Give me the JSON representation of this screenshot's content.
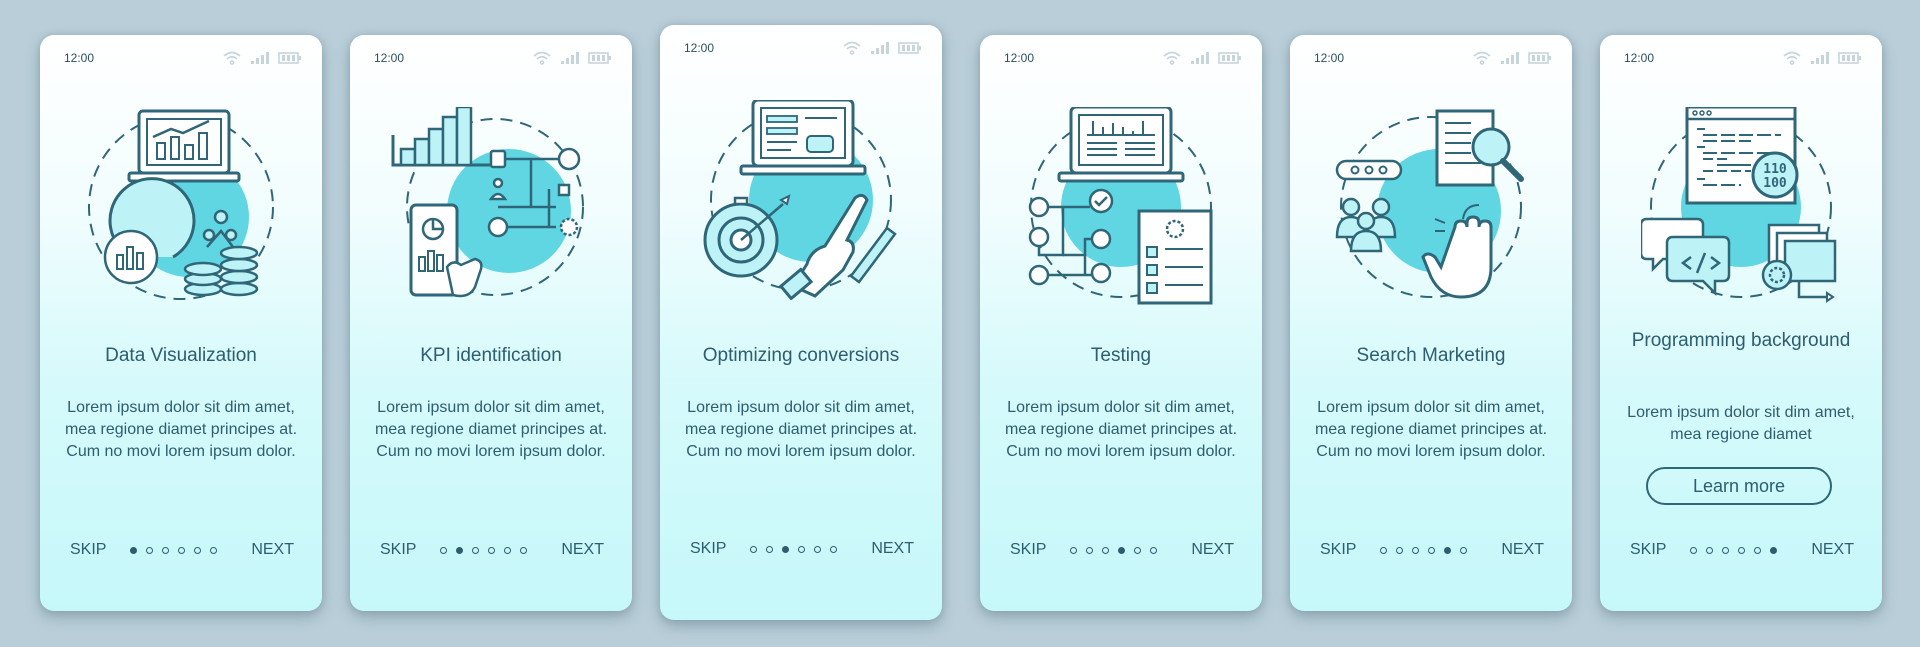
{
  "colors": {
    "background": "#b9ced8",
    "accent": "#5fd6e2",
    "text": "#2d5d70",
    "line": "#2f6678"
  },
  "status_bar": {
    "time": "12:00",
    "icons": [
      "wifi-icon",
      "signal-icon",
      "battery-icon"
    ]
  },
  "nav": {
    "skip_label": "SKIP",
    "next_label": "NEXT",
    "total_steps": 6
  },
  "screens": [
    {
      "title": "Data Visualization",
      "body": "Lorem ipsum dolor sit dim amet, mea regione diamet principes at. Cum no movi lorem ipsum dolor.",
      "illustration": "data-visualization-illustration",
      "active_step": 1
    },
    {
      "title": "KPI identification",
      "body": "Lorem ipsum dolor sit dim amet, mea regione diamet principes at. Cum no movi lorem ipsum dolor.",
      "illustration": "kpi-identification-illustration",
      "active_step": 2
    },
    {
      "title": "Optimizing conversions",
      "body": "Lorem ipsum dolor sit dim amet, mea regione diamet principes at. Cum no movi lorem ipsum dolor.",
      "illustration": "optimizing-conversions-illustration",
      "active_step": 3
    },
    {
      "title": "Testing",
      "body": "Lorem ipsum dolor sit dim amet, mea regione diamet principes at. Cum no movi lorem ipsum dolor.",
      "illustration": "testing-illustration",
      "active_step": 4
    },
    {
      "title": "Search Marketing",
      "body": "Lorem ipsum dolor sit dim amet, mea regione diamet principes at. Cum no movi lorem ipsum dolor.",
      "illustration": "search-marketing-illustration",
      "active_step": 5
    },
    {
      "title": "Programming background",
      "body": "Lorem ipsum dolor sit dim amet, mea regione diamet",
      "illustration": "programming-background-illustration",
      "button_label": "Learn more",
      "active_step": 6
    }
  ]
}
